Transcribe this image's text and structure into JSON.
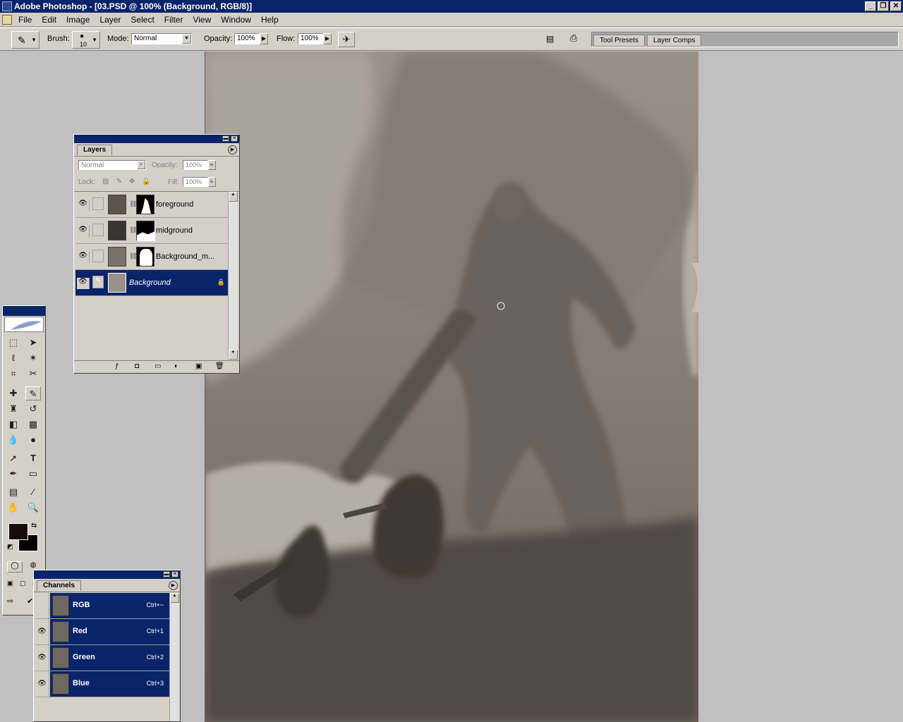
{
  "app": {
    "title": "Adobe Photoshop - [03.PSD @ 100% (Background, RGB/8)]"
  },
  "menu": {
    "items": [
      "File",
      "Edit",
      "Image",
      "Layer",
      "Select",
      "Filter",
      "View",
      "Window",
      "Help"
    ]
  },
  "options_bar": {
    "brush_label": "Brush:",
    "brush_size": "10",
    "mode_label": "Mode:",
    "mode_value": "Normal",
    "opacity_label": "Opacity:",
    "opacity_value": "100%",
    "flow_label": "Flow:",
    "flow_value": "100%"
  },
  "palette_well": {
    "tabs": [
      "Tool Presets",
      "Layer Comps"
    ]
  },
  "layers_palette": {
    "tab": "Layers",
    "blend_mode": "Normal",
    "opacity_label": "Opacity:",
    "opacity_value": "100%",
    "lock_label": "Lock:",
    "fill_label": "Fill:",
    "fill_value": "100%",
    "layers": [
      {
        "name": "foreground",
        "visible": true,
        "selected": false
      },
      {
        "name": "midground",
        "visible": true,
        "selected": false
      },
      {
        "name": "Background_m...",
        "visible": true,
        "selected": false
      },
      {
        "name": "Background",
        "visible": true,
        "selected": true,
        "locked": true
      }
    ]
  },
  "channels_palette": {
    "tab": "Channels",
    "channels": [
      {
        "name": "RGB",
        "shortcut": "Ctrl+~",
        "visible": false
      },
      {
        "name": "Red",
        "shortcut": "Ctrl+1",
        "visible": true
      },
      {
        "name": "Green",
        "shortcut": "Ctrl+2",
        "visible": true
      },
      {
        "name": "Blue",
        "shortcut": "Ctrl+3",
        "visible": true
      }
    ]
  },
  "colors": {
    "title_bar": "#0a246a",
    "chrome": "#d4d0c8",
    "foreground_color": "#1a0a08",
    "background_color": "#000000",
    "canvas_tone": "#8a8178"
  }
}
